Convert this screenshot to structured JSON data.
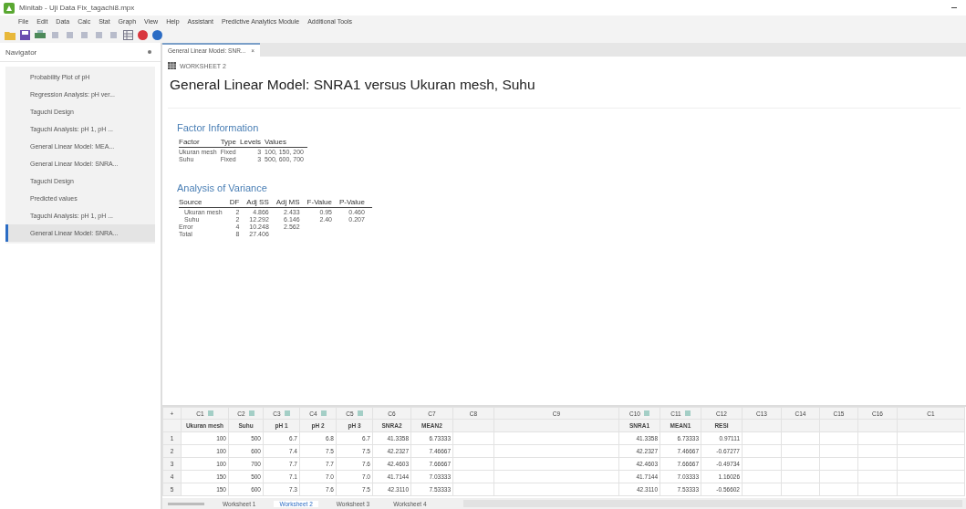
{
  "window": {
    "title": "Minitab - Uji Data Fix_tagachi8.mpx"
  },
  "menu": [
    "File",
    "Edit",
    "Data",
    "Calc",
    "Stat",
    "Graph",
    "View",
    "Help",
    "Assistant",
    "Predictive Analytics Module",
    "Additional Tools"
  ],
  "navigator": {
    "title": "Navigator",
    "items": [
      {
        "label": "Probability Plot of pH",
        "selected": false
      },
      {
        "label": "Regression Analysis: pH ver...",
        "selected": false
      },
      {
        "label": "Taguchi Design",
        "selected": false
      },
      {
        "label": "Taguchi Analysis: pH 1, pH ...",
        "selected": false
      },
      {
        "label": "General Linear Model: MEA...",
        "selected": false
      },
      {
        "label": "General Linear Model: SNRA...",
        "selected": false
      },
      {
        "label": "Taguchi Design",
        "selected": false
      },
      {
        "label": "Predicted values",
        "selected": false
      },
      {
        "label": "Taguchi Analysis: pH 1, pH ...",
        "selected": false
      },
      {
        "label": "General Linear Model: SNRA...",
        "selected": true
      }
    ]
  },
  "doc_tab": {
    "label": "General Linear Model: SNR...",
    "close": "×"
  },
  "output": {
    "worksheet": "WORKSHEET 2",
    "title": "General Linear Model: SNRA1 versus Ukuran mesh, Suhu",
    "factor_info": {
      "heading": "Factor Information",
      "columns": [
        "Factor",
        "Type",
        "Levels",
        "Values"
      ],
      "rows": [
        [
          "Ukuran mesh",
          "Fixed",
          "3",
          "100, 150, 200"
        ],
        [
          "Suhu",
          "Fixed",
          "3",
          "500, 600, 700"
        ]
      ]
    },
    "anova": {
      "heading": "Analysis of Variance",
      "columns": [
        "Source",
        "DF",
        "Adj SS",
        "Adj MS",
        "F-Value",
        "P-Value"
      ],
      "rows": [
        {
          "indent": true,
          "cells": [
            "Ukuran mesh",
            "2",
            "4.866",
            "2.433",
            "0.95",
            "0.460"
          ]
        },
        {
          "indent": true,
          "cells": [
            "Suhu",
            "2",
            "12.292",
            "6.146",
            "2.40",
            "0.207"
          ]
        },
        {
          "indent": false,
          "cells": [
            "Error",
            "4",
            "10.248",
            "2.562",
            "",
            ""
          ]
        },
        {
          "indent": false,
          "cells": [
            "Total",
            "8",
            "27.406",
            "",
            "",
            ""
          ]
        }
      ]
    }
  },
  "worksheet": {
    "corner": "+",
    "columns": [
      {
        "id": "C1",
        "name": "Ukuran mesh",
        "marker": true
      },
      {
        "id": "C2",
        "name": "Suhu",
        "marker": true
      },
      {
        "id": "C3",
        "name": "pH 1",
        "marker": true
      },
      {
        "id": "C4",
        "name": "pH 2",
        "marker": true
      },
      {
        "id": "C5",
        "name": "pH 3",
        "marker": true
      },
      {
        "id": "C6",
        "name": "SNRA2",
        "marker": false
      },
      {
        "id": "C7",
        "name": "MEAN2",
        "marker": false
      },
      {
        "id": "C8",
        "marker": false
      },
      {
        "id": "C9",
        "marker": false
      },
      {
        "id": "C10",
        "name": "SNRA1",
        "marker": true
      },
      {
        "id": "C11",
        "name": "MEAN1",
        "marker": true
      },
      {
        "id": "C12",
        "name": "RESI",
        "marker": false
      },
      {
        "id": "C13",
        "marker": false
      },
      {
        "id": "C14",
        "marker": false
      },
      {
        "id": "C15",
        "marker": false
      },
      {
        "id": "C16",
        "marker": false
      },
      {
        "id": "C1",
        "marker": false
      }
    ],
    "rows": [
      {
        "num": "1",
        "cells": [
          "100",
          "500",
          "6.7",
          "6.8",
          "6.7",
          "41.3358",
          "6.73333",
          "",
          "",
          "41.3358",
          "6.73333",
          "0.97111"
        ]
      },
      {
        "num": "2",
        "cells": [
          "100",
          "600",
          "7.4",
          "7.5",
          "7.5",
          "42.2327",
          "7.46667",
          "",
          "",
          "42.2327",
          "7.46667",
          "-0.67277"
        ]
      },
      {
        "num": "3",
        "cells": [
          "100",
          "700",
          "7.7",
          "7.7",
          "7.6",
          "42.4603",
          "7.66667",
          "",
          "",
          "42.4603",
          "7.66667",
          "-0.49734"
        ]
      },
      {
        "num": "4",
        "cells": [
          "150",
          "500",
          "7.1",
          "7.0",
          "7.0",
          "41.7144",
          "7.03333",
          "",
          "",
          "41.7144",
          "7.03333",
          "1.16026"
        ]
      },
      {
        "num": "5",
        "cells": [
          "150",
          "600",
          "7.3",
          "7.6",
          "7.5",
          "42.3110",
          "7.53333",
          "",
          "",
          "42.3110",
          "7.53333",
          "-0.56602"
        ]
      }
    ],
    "sheets": [
      {
        "label": "Worksheet 1",
        "selected": false
      },
      {
        "label": "Worksheet 2",
        "selected": true
      },
      {
        "label": "Worksheet 3",
        "selected": false
      },
      {
        "label": "Worksheet 4",
        "selected": false
      }
    ]
  }
}
